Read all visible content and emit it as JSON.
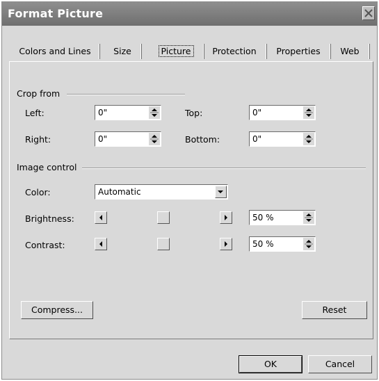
{
  "dialog": {
    "title": "Format Picture"
  },
  "tabs": [
    {
      "label": "Colors and Lines"
    },
    {
      "label": "Size"
    },
    {
      "label": "Picture",
      "active": true
    },
    {
      "label": "Protection"
    },
    {
      "label": "Properties"
    },
    {
      "label": "Web"
    }
  ],
  "crop": {
    "group_label": "Crop from",
    "left": {
      "label": "Left:",
      "value": "0\""
    },
    "top": {
      "label": "Top:",
      "value": "0\""
    },
    "right": {
      "label": "Right:",
      "value": "0\""
    },
    "bottom": {
      "label": "Bottom:",
      "value": "0\""
    }
  },
  "image_control": {
    "group_label": "Image control",
    "color": {
      "label": "Color:",
      "value": "Automatic"
    },
    "brightness": {
      "label": "Brightness:",
      "value": "50 %",
      "level": 0.5
    },
    "contrast": {
      "label": "Contrast:",
      "value": "50 %",
      "level": 0.5
    }
  },
  "buttons": {
    "compress": "Compress...",
    "reset": "Reset",
    "ok": "OK",
    "cancel": "Cancel"
  },
  "colors": {
    "face": "#d9d9d9",
    "title_bar": "#7f7f7f"
  }
}
